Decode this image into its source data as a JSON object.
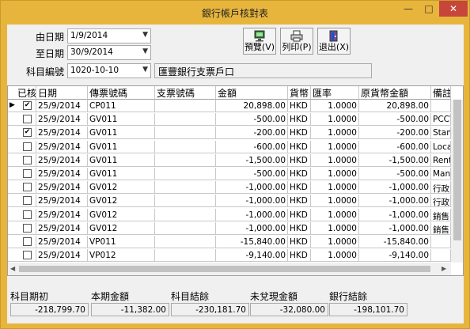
{
  "window": {
    "title": "銀行帳戶核對表",
    "minimize": "—",
    "maximize": "□",
    "close": "✕"
  },
  "filters": {
    "from_date_label": "由日期",
    "from_date_value": "1/9/2014",
    "to_date_label": "至日期",
    "to_date_value": "30/9/2014",
    "account_label": "科目編號",
    "account_value": "1020-10-10",
    "account_name": "匯豐銀行支票戶口"
  },
  "toolbar": {
    "preview_label": "預覽(V)",
    "print_label": "列印(P)",
    "exit_label": "退出(X)"
  },
  "table": {
    "columns": [
      "已核",
      "日期",
      "傳票號碼",
      "支票號碼",
      "金額",
      "貨幣",
      "匯率",
      "原貨幣金額",
      "備註"
    ],
    "rows": [
      {
        "checked": true,
        "date": "25/9/2014",
        "voucher": "CP011",
        "cheque": "",
        "amount": "20,898.00",
        "currency": "HKD",
        "rate": "1.0000",
        "orig": "20,898.00",
        "remark": ""
      },
      {
        "checked": false,
        "date": "25/9/2014",
        "voucher": "GV011",
        "cheque": "",
        "amount": "-500.00",
        "currency": "HKD",
        "rate": "1.0000",
        "orig": "-500.00",
        "remark": "PCCW"
      },
      {
        "checked": true,
        "date": "25/9/2014",
        "voucher": "GV011",
        "cheque": "",
        "amount": "-200.00",
        "currency": "HKD",
        "rate": "1.0000",
        "orig": "-200.00",
        "remark": "Stam"
      },
      {
        "checked": false,
        "date": "25/9/2014",
        "voucher": "GV011",
        "cheque": "",
        "amount": "-600.00",
        "currency": "HKD",
        "rate": "1.0000",
        "orig": "-600.00",
        "remark": "Local"
      },
      {
        "checked": false,
        "date": "25/9/2014",
        "voucher": "GV011",
        "cheque": "",
        "amount": "-1,500.00",
        "currency": "HKD",
        "rate": "1.0000",
        "orig": "-1,500.00",
        "remark": "Rent"
      },
      {
        "checked": false,
        "date": "25/9/2014",
        "voucher": "GV011",
        "cheque": "",
        "amount": "-500.00",
        "currency": "HKD",
        "rate": "1.0000",
        "orig": "-500.00",
        "remark": "Mana"
      },
      {
        "checked": false,
        "date": "25/9/2014",
        "voucher": "GV012",
        "cheque": "",
        "amount": "-1,000.00",
        "currency": "HKD",
        "rate": "1.0000",
        "orig": "-1,000.00",
        "remark": "行政"
      },
      {
        "checked": false,
        "date": "25/9/2014",
        "voucher": "GV012",
        "cheque": "",
        "amount": "-1,000.00",
        "currency": "HKD",
        "rate": "1.0000",
        "orig": "-1,000.00",
        "remark": "行政"
      },
      {
        "checked": false,
        "date": "25/9/2014",
        "voucher": "GV012",
        "cheque": "",
        "amount": "-1,000.00",
        "currency": "HKD",
        "rate": "1.0000",
        "orig": "-1,000.00",
        "remark": "銷售"
      },
      {
        "checked": false,
        "date": "25/9/2014",
        "voucher": "GV012",
        "cheque": "",
        "amount": "-1,000.00",
        "currency": "HKD",
        "rate": "1.0000",
        "orig": "-1,000.00",
        "remark": "銷售"
      },
      {
        "checked": false,
        "date": "25/9/2014",
        "voucher": "VP011",
        "cheque": "",
        "amount": "-15,840.00",
        "currency": "HKD",
        "rate": "1.0000",
        "orig": "-15,840.00",
        "remark": ""
      },
      {
        "checked": false,
        "date": "25/9/2014",
        "voucher": "VP012",
        "cheque": "",
        "amount": "-9,140.00",
        "currency": "HKD",
        "rate": "1.0000",
        "orig": "-9,140.00",
        "remark": ""
      }
    ]
  },
  "summary": {
    "opening_label": "科目期初",
    "opening_value": "-218,799.70",
    "period_label": "本期金額",
    "period_value": "-11,382.00",
    "closing_label": "科目結餘",
    "closing_value": "-230,181.70",
    "uncleared_label": "未兌現金額",
    "uncleared_value": "-32,080.00",
    "bank_label": "銀行結餘",
    "bank_value": "-198,101.70"
  },
  "colors": {
    "title_bar": "#e8b53c",
    "close_button": "#c7463a",
    "client": "#f0f0f0"
  },
  "icons": {
    "preview": "monitor-icon",
    "print": "printer-icon",
    "exit": "exit-door-icon"
  }
}
